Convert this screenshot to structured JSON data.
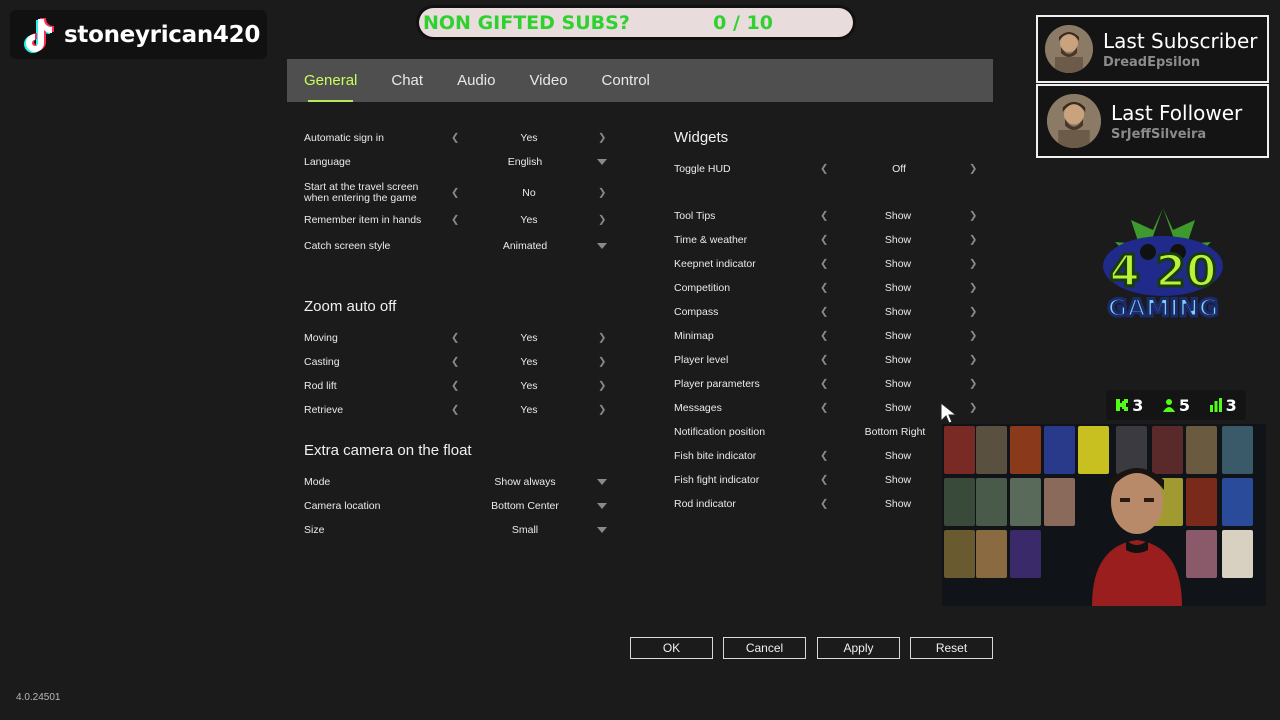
{
  "overlay": {
    "tiktok_name": "stoneyrican420",
    "subs_goal": {
      "label": "NON GIFTED SUBS?",
      "count": "0 / 10"
    },
    "last_subscriber": {
      "title": "Last Subscriber",
      "name": "DreadEpsilon"
    },
    "last_follower": {
      "title": "Last Follower",
      "name": "SrJeffSilveira"
    },
    "stats": {
      "kick": "3",
      "followers": "5",
      "viewers": "3"
    }
  },
  "tabs": [
    {
      "label": "General",
      "active": true
    },
    {
      "label": "Chat",
      "active": false
    },
    {
      "label": "Audio",
      "active": false
    },
    {
      "label": "Video",
      "active": false
    },
    {
      "label": "Control",
      "active": false
    }
  ],
  "left": {
    "general_rows": [
      {
        "label": "Automatic sign in",
        "value": "Yes",
        "control": "arrows"
      },
      {
        "label": "Language",
        "value": "English",
        "control": "dropdown"
      },
      {
        "label": "Start at the travel screen when entering the game",
        "value": "No",
        "control": "arrows"
      },
      {
        "label": "Remember item in hands",
        "value": "Yes",
        "control": "arrows"
      },
      {
        "label": "Catch screen style",
        "value": "Animated",
        "control": "dropdown"
      }
    ],
    "zoom_title": "Zoom auto off",
    "zoom_rows": [
      {
        "label": "Moving",
        "value": "Yes"
      },
      {
        "label": "Casting",
        "value": "Yes"
      },
      {
        "label": "Rod lift",
        "value": "Yes"
      },
      {
        "label": "Retrieve",
        "value": "Yes"
      }
    ],
    "camera_title": "Extra camera on the float",
    "camera_rows": [
      {
        "label": "Mode",
        "value": "Show always"
      },
      {
        "label": "Camera location",
        "value": "Bottom Center"
      },
      {
        "label": "Size",
        "value": "Small"
      }
    ]
  },
  "right": {
    "widgets_title": "Widgets",
    "toggle_hud": {
      "label": "Toggle HUD",
      "value": "Off"
    },
    "rows": [
      {
        "label": "Tool Tips",
        "value": "Show",
        "arrows": true
      },
      {
        "label": "Time & weather",
        "value": "Show",
        "arrows": true
      },
      {
        "label": "Keepnet indicator",
        "value": "Show",
        "arrows": true
      },
      {
        "label": "Competition",
        "value": "Show",
        "arrows": true
      },
      {
        "label": "Compass",
        "value": "Show",
        "arrows": true
      },
      {
        "label": "Minimap",
        "value": "Show",
        "arrows": true
      },
      {
        "label": "Player level",
        "value": "Show",
        "arrows": true
      },
      {
        "label": "Player parameters",
        "value": "Show",
        "arrows": true
      },
      {
        "label": "Messages",
        "value": "Show",
        "arrows": true
      },
      {
        "label": "Notification position",
        "value": "Bottom Right",
        "arrows": false
      },
      {
        "label": "Fish bite indicator",
        "value": "Show",
        "arrows": true
      },
      {
        "label": "Fish fight indicator",
        "value": "Show",
        "arrows": true
      },
      {
        "label": "Rod indicator",
        "value": "Show",
        "arrows": true
      }
    ]
  },
  "buttons": {
    "ok": "OK",
    "cancel": "Cancel",
    "apply": "Apply",
    "reset": "Reset"
  },
  "version": "4.0.24501",
  "colors": {
    "accent": "#c9ff5a",
    "tabbar": "#4f4f4f",
    "background": "#1b1b1b",
    "subs_text": "#2fd12f"
  }
}
